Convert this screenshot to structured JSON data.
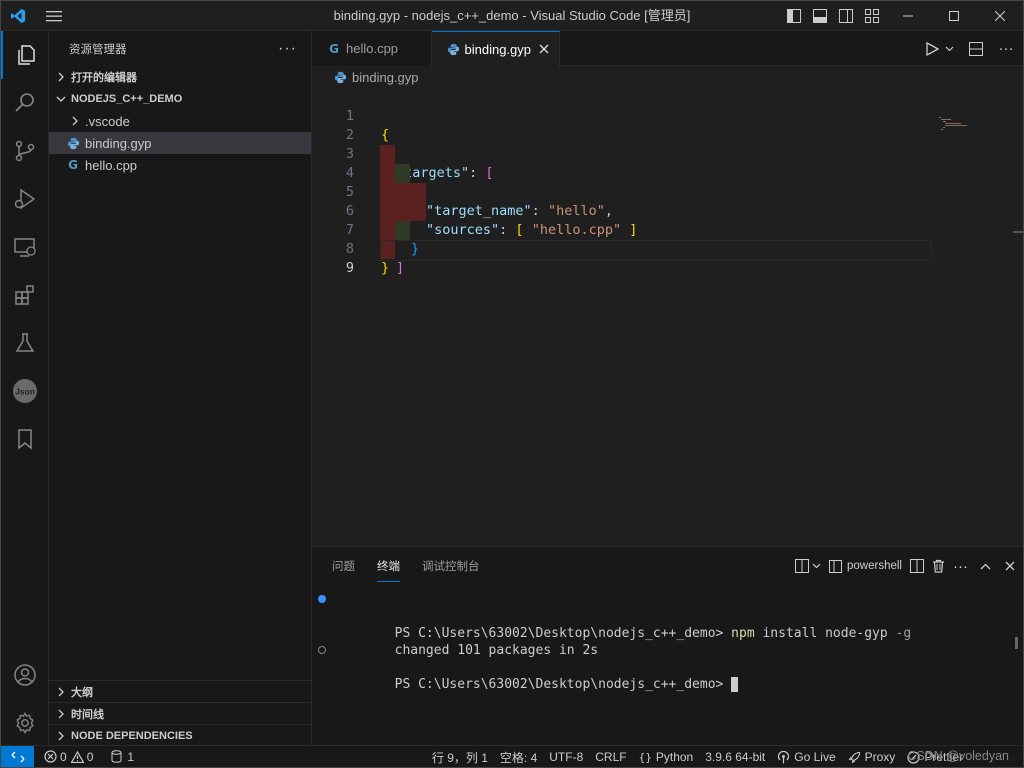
{
  "window": {
    "title": "binding.gyp - nodejs_c++_demo - Visual Studio Code [管理员]"
  },
  "sidebar": {
    "title": "资源管理器",
    "open_editors_label": "打开的编辑器",
    "project_label": "NODEJS_C++_DEMO",
    "tree": [
      {
        "name": ".vscode",
        "type": "folder"
      },
      {
        "name": "binding.gyp",
        "type": "python-file",
        "selected": true
      },
      {
        "name": "hello.cpp",
        "type": "cpp-file"
      }
    ],
    "bottom_sections": [
      "大纲",
      "时间线",
      "NODE DEPENDENCIES"
    ]
  },
  "editor": {
    "tabs": [
      {
        "label": "hello.cpp",
        "active": false
      },
      {
        "label": "binding.gyp",
        "active": true
      }
    ],
    "breadcrumb": "binding.gyp",
    "line_numbers": [
      "1",
      "2",
      "3",
      "4",
      "5",
      "6",
      "7",
      "8",
      "9"
    ],
    "current_line": "9",
    "code": {
      "l1_open": "{",
      "l2_key": "\"targets\"",
      "l2_colon": ": ",
      "l2_bracket": "[",
      "l3_brace": "{",
      "l4_key": "\"target_name\"",
      "l4_colon": ": ",
      "l4_val": "\"hello\"",
      "l4_comma": ",",
      "l5_key": "\"sources\"",
      "l5_colon": ": ",
      "l5_open": "[",
      "l5_val": " \"hello.cpp\" ",
      "l5_close": "]",
      "l6_brace": "}",
      "l7_bracket": "]",
      "l8_close": "}"
    }
  },
  "panel": {
    "tabs": [
      "问题",
      "终端",
      "调试控制台"
    ],
    "active_tab": "终端",
    "shell_label": "powershell",
    "terminal": {
      "line1_prompt": "PS C:\\Users\\63002\\Desktop\\nodejs_c++_demo> ",
      "line1_cmd": "npm",
      "line1_args": " install node-gyp ",
      "line1_flag": "-g",
      "line2": "changed 101 packages in 2s",
      "line3_prompt": "PS C:\\Users\\63002\\Desktop\\nodejs_c++_demo> "
    }
  },
  "status": {
    "errors": "0",
    "warnings": "0",
    "ports": "1",
    "position": "行 9，列 1",
    "spaces": "空格: 4",
    "encoding": "UTF-8",
    "eol": "CRLF",
    "language": "Python",
    "interpreter": "3.9.6 64-bit",
    "golive": "Go Live",
    "proxy": "Proxy",
    "prettier": "Prettier",
    "watermark": "CSDN @voledyan"
  },
  "colors": {
    "accent": "#0078d4",
    "string": "#ce9178",
    "key": "#9cdcfe",
    "bracket_gold": "#ffd700",
    "bracket_purple": "#da70d6",
    "bracket_blue": "#179fff"
  }
}
